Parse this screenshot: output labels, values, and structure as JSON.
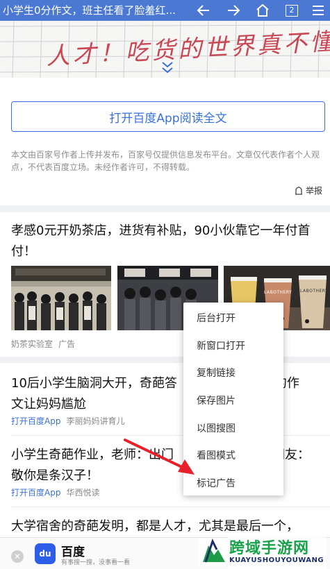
{
  "topbar": {
    "title": "小学生0分作文，班主任看了脸羞红...",
    "tab_count": "2"
  },
  "article": {
    "handwriting_text": "人才！吃货的世界真不懂！",
    "open_app_label": "打开百度App阅读全文",
    "disclaimer": "本文由百家号作者上传并发布，百家号仅提供信息发布平台。文章仅代表作者个人观点，不代表百度立场。未经作者许可，不得转载。",
    "report_label": "举报"
  },
  "ad": {
    "title": "孝感0元开奶茶店，进货有补贴，90小伙靠它一年付首付！",
    "source": "奶茶实验室",
    "tag": "广告",
    "cup_text": "LABOTHERY"
  },
  "feed": [
    {
      "title": "10后小学生脑洞大开，奇葩答案，看到最后的作文让妈妈尴尬",
      "line1": "10后小学生脑洞大开，奇葩答",
      "line1b": "后的作",
      "line2": "文让妈妈尴尬",
      "app_link": "打开百度App",
      "source": "李丽妈妈讲育儿"
    },
    {
      "line1": "小学生奇葩作业，老师：出门",
      "line1b": "网友：",
      "line2": "敬你是条汉子！",
      "app_link": "打开百度App",
      "source": "华西悦读"
    },
    {
      "line1": "大学宿舍的奇葩发明，都是人才，尤其是最后一个，"
    }
  ],
  "context_menu": {
    "items": [
      "后台打开",
      "新窗口打开",
      "复制链接",
      "保存图片",
      "以图搜图",
      "看图模式",
      "标记广告"
    ]
  },
  "bottombar": {
    "logo_text": "du",
    "app_name": "百度",
    "slogan": "有事搜一搜，没事看一看"
  },
  "watermark": {
    "name": "跨域手游网",
    "url": "KUAYUSHOUYOUWANG"
  },
  "colors": {
    "topbar": "#4a78d2",
    "link_blue": "#3a71d8",
    "arrow_red": "#e8202a",
    "baidu_blue": "#2c5ee8"
  }
}
